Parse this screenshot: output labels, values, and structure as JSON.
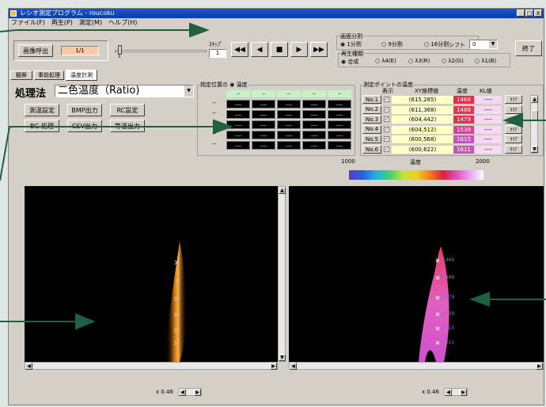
{
  "window": {
    "title": "レシオ測定プログラム - roucoku",
    "min_label": "_",
    "max_label": "□",
    "close_label": "X"
  },
  "menu": [
    "ファイル(F)",
    "再生(P)",
    "測定(M)",
    "ヘルプ(H)"
  ],
  "toolbar": {
    "load_image_label": "画像呼出",
    "frame_counter": "1/1",
    "slider_tick": "1",
    "skip_label": "ｽｷｯﾌﾟ",
    "skip_value": "1",
    "screen_split": {
      "label": "画面分割",
      "options": [
        "1分割",
        "9分割",
        "16分割"
      ],
      "selected": 0
    },
    "shift_label": "シフト",
    "shift_value": "0",
    "playback_type": {
      "label": "再生種類",
      "options": [
        "合成",
        "λ4(E)",
        "λ3(R)",
        "λ2(G)",
        "λ1(B)"
      ],
      "selected": 0
    },
    "exit_label": "終了"
  },
  "tabs": [
    "観察",
    "事前処理",
    "温度計測"
  ],
  "active_tab": 2,
  "method": {
    "label": "処理法",
    "value": "二色温度（Ratio)"
  },
  "action_buttons": [
    "測温設定",
    "BMP出力",
    "RC設定",
    "BG 処理",
    "CSV出力",
    "等温出力"
  ],
  "position_temp": {
    "label": "指定位置の",
    "radio_label": "温度",
    "header": [
      "--",
      "--",
      "--",
      "--",
      "--"
    ],
    "row_label": "--",
    "cell": "----",
    "rows": 5,
    "cols": 5
  },
  "points": {
    "label": "測定ポイントの温度",
    "headers": {
      "show": "表示",
      "coord": "XY座標値",
      "temp": "温度",
      "kl": "KL値"
    },
    "rows": [
      {
        "no": "No.1",
        "coord": "(615,285)",
        "temp": "1466",
        "kl": "----",
        "clear": "ｸﾘｱ",
        "color": "#e0304a"
      },
      {
        "no": "No.2",
        "coord": "(611,368)",
        "temp": "1488",
        "kl": "----",
        "clear": "ｸﾘｱ",
        "color": "#e03858"
      },
      {
        "no": "No.3",
        "coord": "(604,442)",
        "temp": "1479",
        "kl": "----",
        "clear": "ｸﾘｱ",
        "color": "#e0305a"
      },
      {
        "no": "No.4",
        "coord": "(604,512)",
        "temp": "1539",
        "kl": "----",
        "clear": "ｸﾘｱ",
        "color": "#d04890"
      },
      {
        "no": "No.5",
        "coord": "(600,568)",
        "temp": "1615",
        "kl": "----",
        "clear": "ｸﾘｱ",
        "color": "#c058b8"
      },
      {
        "no": "No.6",
        "coord": "(600,622)",
        "temp": "1611",
        "kl": "----",
        "clear": "ｸﾘｱ",
        "color": "#c058b8"
      }
    ]
  },
  "colorbar": {
    "min": "1000",
    "label": "温度",
    "max": "2000"
  },
  "left_view": {
    "zoom_label": "x 0.46"
  },
  "right_view": {
    "zoom_label": "x 0.46",
    "point_labels": [
      "1466",
      "1488",
      "1479",
      "1539",
      "1615",
      "1611"
    ]
  },
  "colors": {
    "titlebar": "#0a3aa8",
    "annotation_arrow": "#1e6040",
    "frame_field": "#f8c8a8",
    "tab_active": "#ffffff"
  }
}
